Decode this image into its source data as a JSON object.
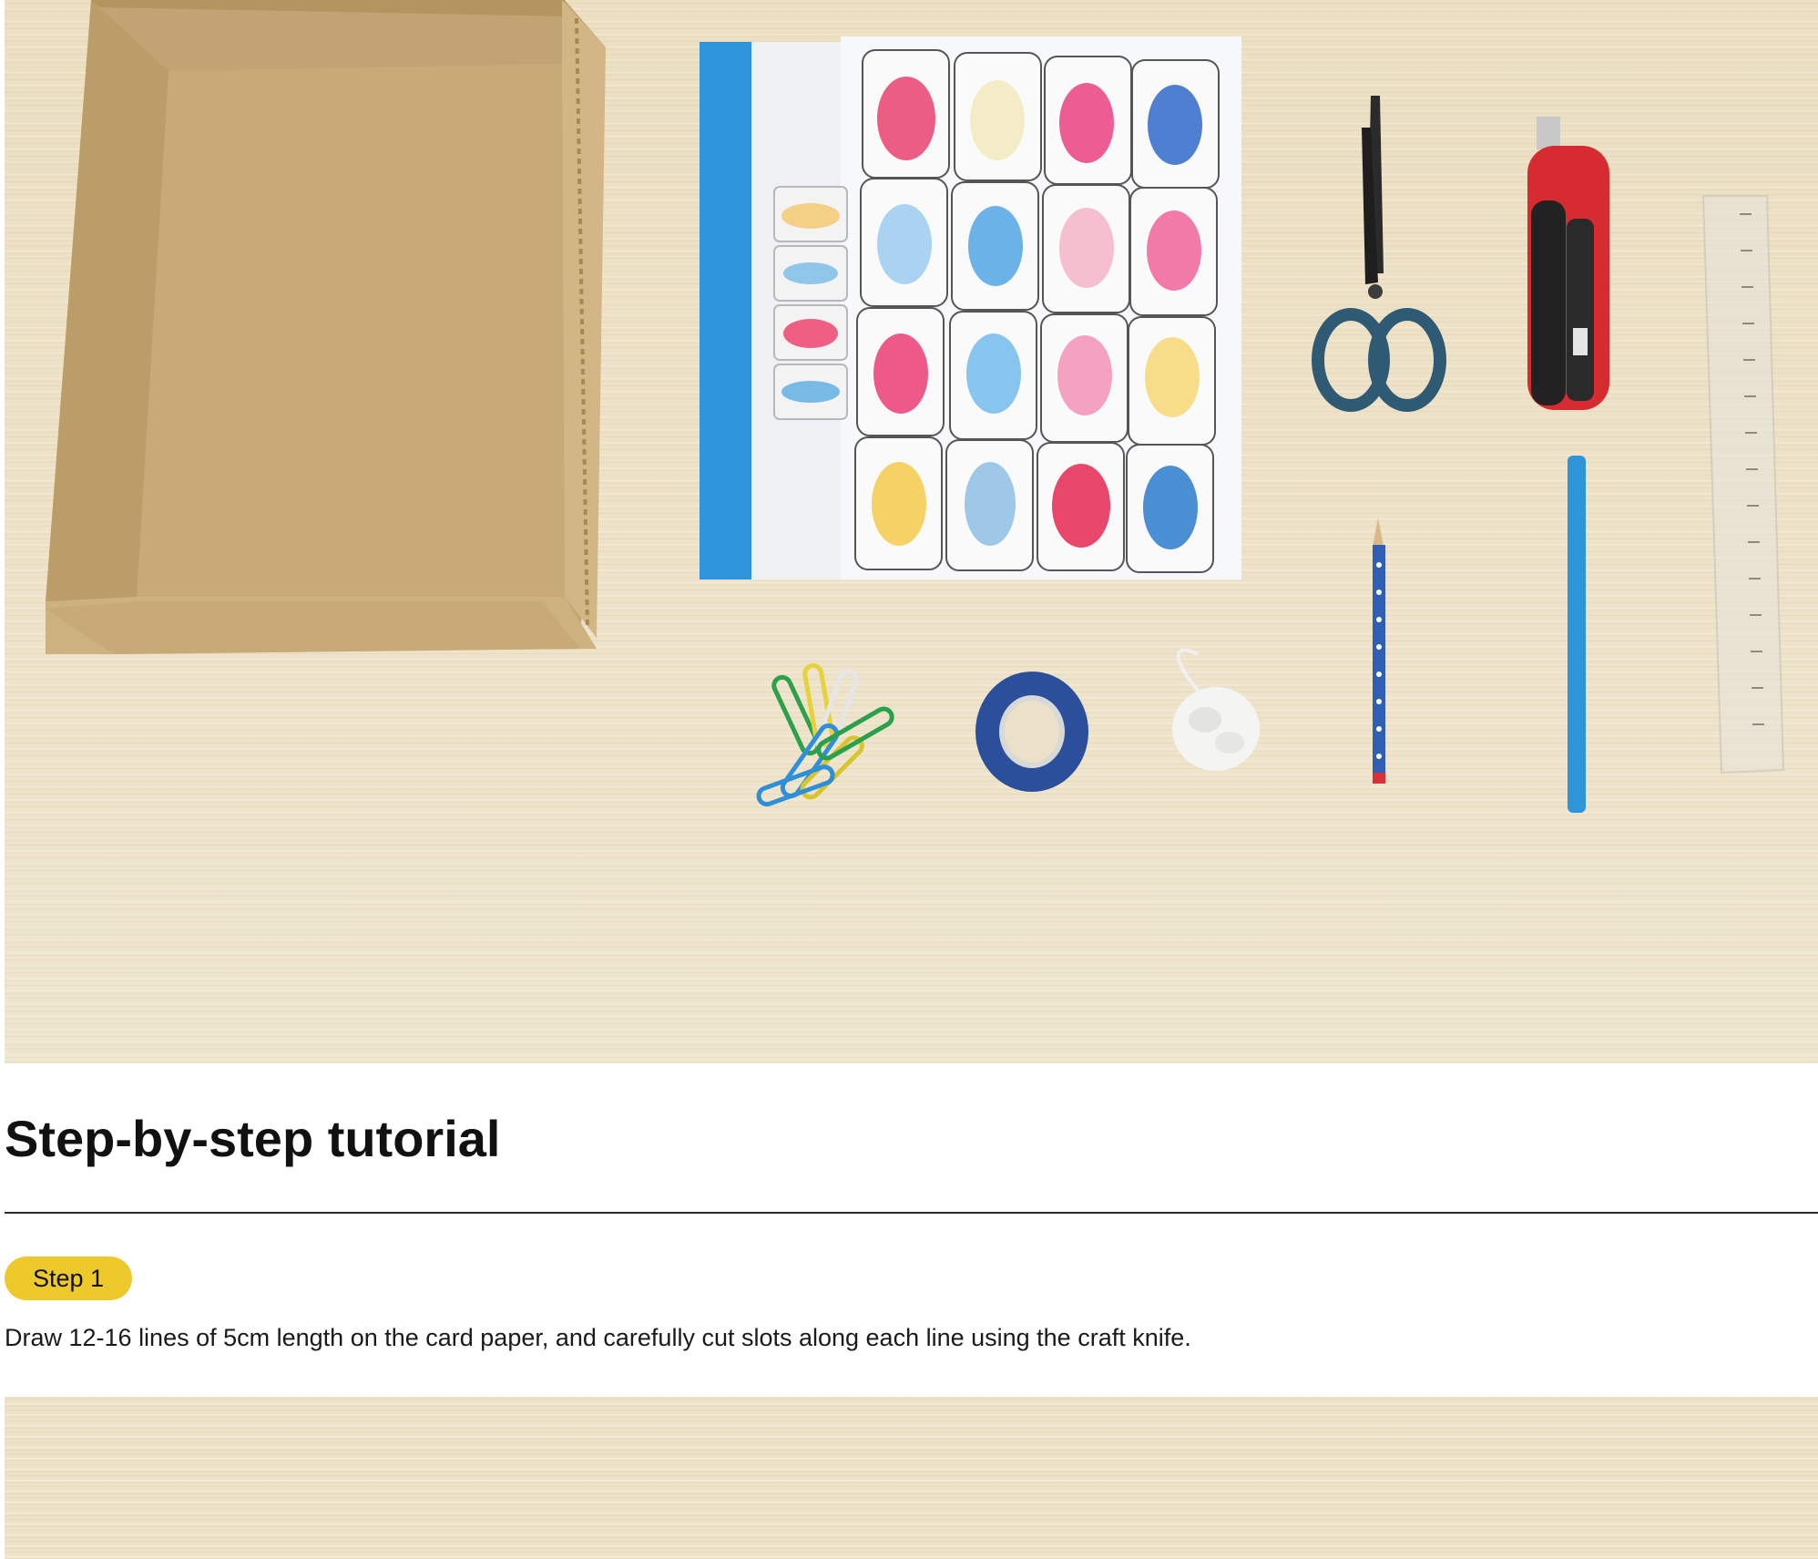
{
  "tutorial": {
    "title": "Step-by-step tutorial",
    "step_badge": "Step 1",
    "step_text": "Draw 12-16 lines of 5cm length on the card paper, and carefully cut slots along each line using the craft knife."
  },
  "colors": {
    "badge": "#EEC92C",
    "rule": "#2A2A2A",
    "desk": "#EADFC4",
    "box": "#C9AC7C",
    "folder_blue": "#2F95DB"
  },
  "icons": {
    "scissors": "scissors-icon",
    "knife": "craft-knife-icon",
    "tape": "tape-roll-icon",
    "pencil": "pencil-icon"
  }
}
